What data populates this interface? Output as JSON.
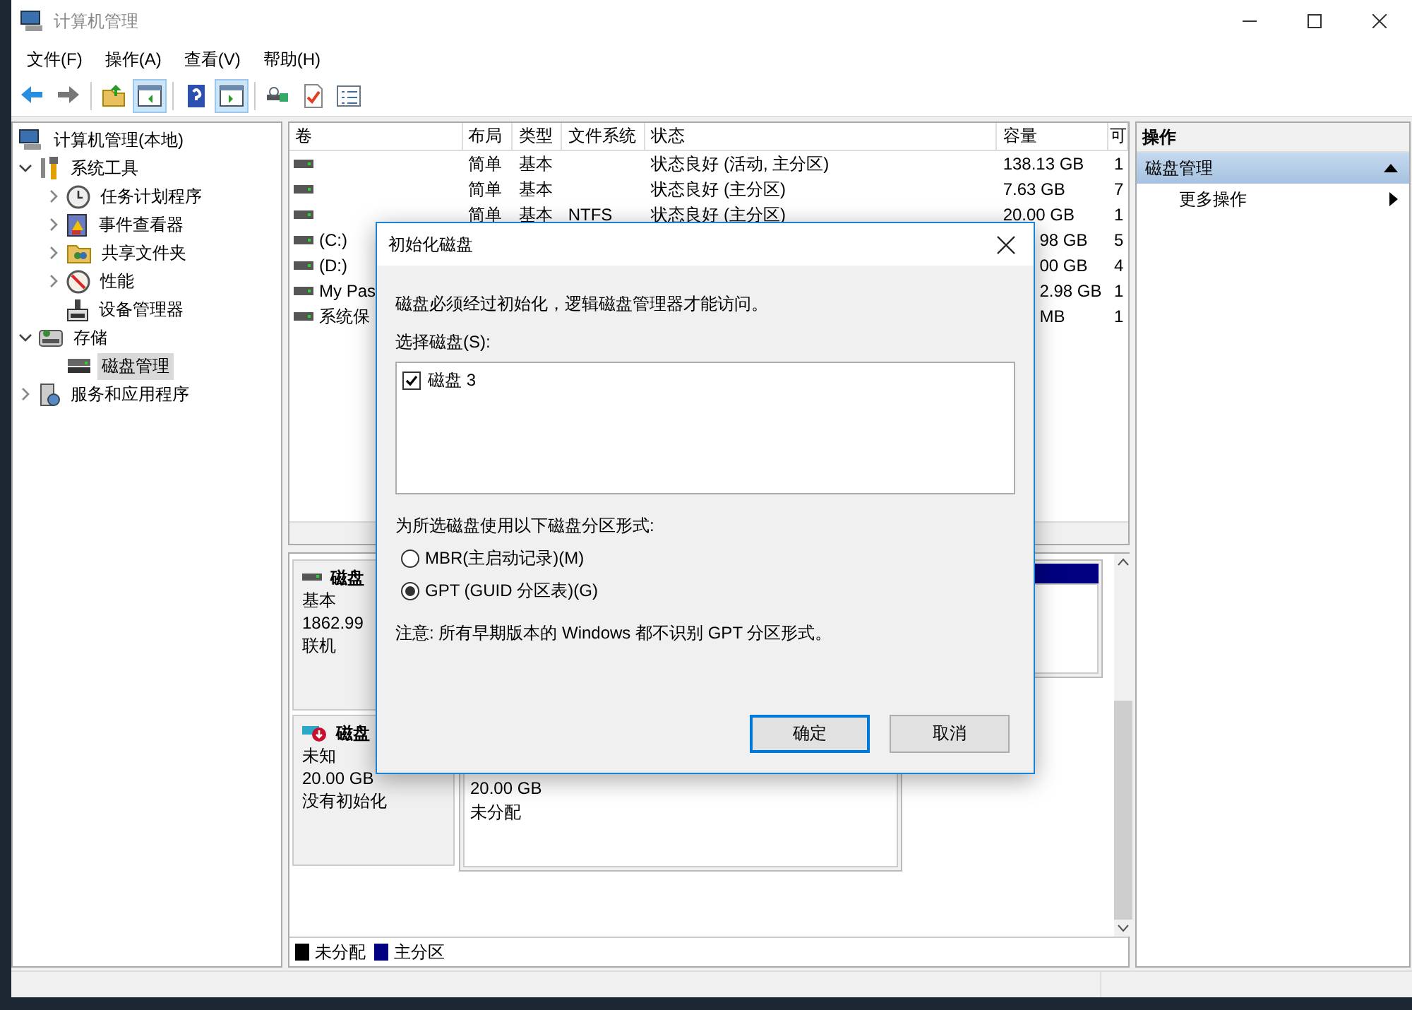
{
  "window": {
    "title": "计算机管理"
  },
  "menu": [
    "文件(F)",
    "操作(A)",
    "查看(V)",
    "帮助(H)"
  ],
  "toolbar": [
    {
      "pressed": false
    },
    {
      "pressed": false
    },
    {
      "pressed": false
    },
    {
      "pressed": true
    },
    {
      "pressed": false
    },
    {
      "pressed": true
    },
    {
      "pressed": false
    },
    {
      "pressed": false
    },
    {
      "pressed": false
    }
  ],
  "tree": [
    {
      "label": "计算机管理(本地)",
      "kind": "root",
      "selected": false,
      "children": [
        {
          "label": "系统工具",
          "kind": "branch",
          "expanded": true,
          "selected": false,
          "children": [
            {
              "label": "任务计划程序",
              "kind": "branch",
              "expanded": false,
              "selected": false
            },
            {
              "label": "事件查看器",
              "kind": "branch",
              "expanded": false,
              "selected": false
            },
            {
              "label": "共享文件夹",
              "kind": "branch",
              "expanded": false,
              "selected": false
            },
            {
              "label": "性能",
              "kind": "branch",
              "expanded": false,
              "selected": false
            },
            {
              "label": "设备管理器",
              "kind": "leaf",
              "selected": false
            }
          ]
        },
        {
          "label": "存储",
          "kind": "branch",
          "expanded": true,
          "selected": false,
          "children": [
            {
              "label": "磁盘管理",
              "kind": "leaf",
              "selected": true
            }
          ]
        },
        {
          "label": "服务和应用程序",
          "kind": "branch",
          "expanded": false,
          "selected": false
        }
      ]
    }
  ],
  "table": {
    "columns": [
      "卷",
      "布局",
      "类型",
      "文件系统",
      "状态",
      "容量",
      "可"
    ],
    "rows": [
      {
        "layout": "简单",
        "type": "基本",
        "status": "状态良好 (活动, 主分区)",
        "capacity": "138.13 GB",
        "column_7": "1"
      },
      {
        "layout": "简单",
        "type": "基本",
        "status": "状态良好 (主分区)",
        "capacity": "7.63 GB",
        "column_7": "7"
      },
      {
        "layout": "简单",
        "type": "基本",
        "file_system": "NTFS",
        "status": "状态良好 (主分区)",
        "capacity": "20.00 GB",
        "column_7": "1"
      },
      {
        "volume": "(C:)",
        "capacity": "98 GB",
        "column_7": "5"
      },
      {
        "volume": "(D:)",
        "capacity": "00 GB",
        "column_7": "4"
      },
      {
        "volume": "My Pas",
        "capacity": "2.98 GB",
        "column_7": "1"
      },
      {
        "volume": "系统保",
        "capacity": "MB",
        "column_7": "1"
      }
    ]
  },
  "disks": [
    {
      "name": "磁盘",
      "type": "基本",
      "size": "1862.99",
      "status": "联机",
      "partitions": [
        {
          "color": "#000080"
        }
      ]
    },
    {
      "name": "磁盘",
      "type": "未知",
      "size": "20.00 GB",
      "status": "没有初始化",
      "partitions": [
        {
          "size": "20.00 GB",
          "status": "未分配"
        }
      ]
    }
  ],
  "legend": [
    {
      "label": "未分配",
      "color": "#000000"
    },
    {
      "label": "主分区",
      "color": "#000080"
    }
  ],
  "actions": {
    "title": "操作",
    "section": {
      "label": "磁盘管理",
      "expanded": true
    },
    "items": [
      "更多操作"
    ]
  },
  "dialog": {
    "title": "初始化磁盘",
    "message": "磁盘必须经过初始化，逻辑磁盘管理器才能访问。",
    "list_label": "选择磁盘(S):",
    "disks": [
      {
        "label": "磁盘 3",
        "checked": true
      }
    ],
    "style_label": "为所选磁盘使用以下磁盘分区形式:",
    "styles": [
      {
        "label": "MBR(主启动记录)(M)",
        "selected": false
      },
      {
        "label": "GPT (GUID 分区表)(G)",
        "selected": true
      }
    ],
    "note": "注意: 所有早期版本的 Windows 都不识别 GPT 分区形式。",
    "buttons": [
      {
        "label": "确定",
        "default": true
      },
      {
        "label": "取消",
        "default": false
      }
    ]
  }
}
